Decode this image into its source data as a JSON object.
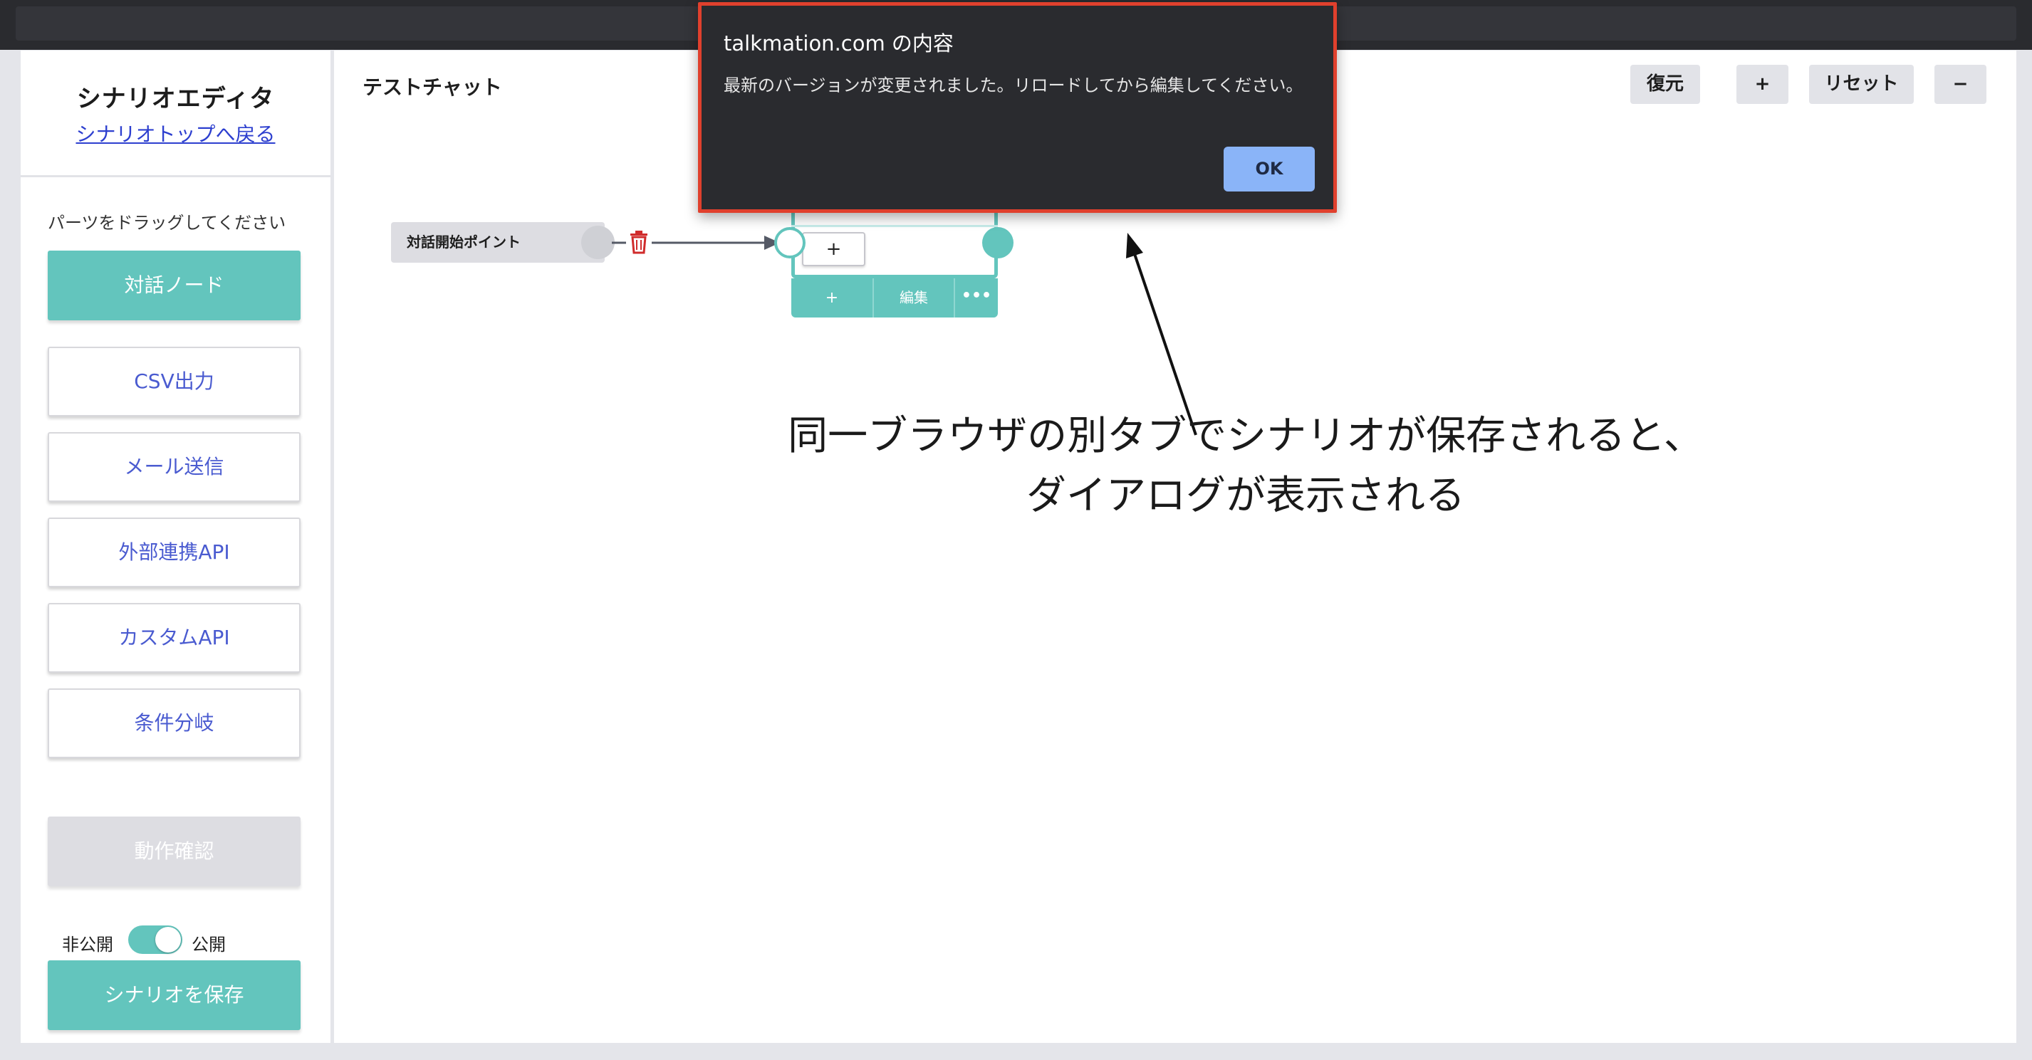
{
  "sidebar": {
    "title": "シナリオエディタ",
    "back_link": "シナリオトップへ戻る",
    "drag_hint": "パーツをドラッグしてください",
    "parts": [
      {
        "label": "対話ノード"
      },
      {
        "label": "CSV出力"
      },
      {
        "label": "メール送信"
      },
      {
        "label": "外部連携API"
      },
      {
        "label": "カスタムAPI"
      },
      {
        "label": "条件分岐"
      }
    ],
    "test_button": "動作確認",
    "publish_off": "非公開",
    "publish_on": "公開",
    "publish_enabled": true,
    "save_button": "シナリオを保存"
  },
  "canvas": {
    "title": "テストチャット",
    "controls": {
      "restore": "復元",
      "zoom_in": "+",
      "reset": "リセット",
      "zoom_out": "−"
    },
    "start_node": "対話開始ポイント",
    "dialog_node": {
      "add_label": "+",
      "footer_add": "+",
      "footer_edit": "編集",
      "footer_more": "•••"
    }
  },
  "annotation": {
    "line1": "同一ブラウザの別タブでシナリオが保存されると、",
    "line2": "ダイアログが表示される"
  },
  "alert": {
    "title": "talkmation.com の内容",
    "message": "最新のバージョンが変更されました。リロードしてから編集してください。",
    "ok": "OK"
  },
  "colors": {
    "accent_teal": "#63c5bd",
    "link_blue": "#2d3fcf",
    "alert_border": "#e0402d",
    "ok_button": "#8ab4f8"
  }
}
